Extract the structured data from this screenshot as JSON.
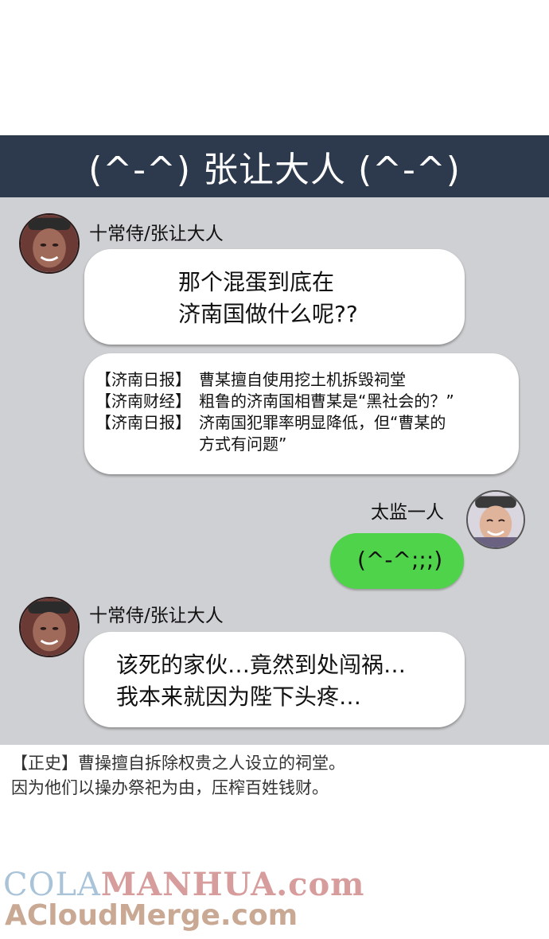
{
  "header": {
    "title": "(^-^) 张让大人 (^-^)"
  },
  "messages": [
    {
      "sender": "十常侍/张让大人",
      "text": "那个混蛋到底在\n济南国做什么呢??"
    },
    {
      "news": [
        {
          "tag": "【济南日报】",
          "text": "曹某擅自使用挖土机拆毁祠堂"
        },
        {
          "tag": "【济南财经】",
          "text": "粗鲁的济南国相曹某是“黑社会的？”"
        },
        {
          "tag": "【济南日报】",
          "text": "济南国犯罪率明显降低，但“曹某的\n方式有问题”"
        }
      ]
    },
    {
      "sender": "太监一人",
      "text": "(^-^;;;)"
    },
    {
      "sender": "十常侍/张让大人",
      "text": "该死的家伙…竟然到处闯祸…\n我本来就因为陛下头疼…"
    }
  ],
  "footnote": "【正史】曹操擅自拆除权贵之人设立的祠堂。\n因为他们以操办祭祀为由，压榨百姓钱财。",
  "watermark": {
    "part1": "COLA",
    "part2": "MANHUA.com",
    "line2": "ACloudMerge.com"
  },
  "colors": {
    "header_bg": "#2d3a4d",
    "chat_bg": "#cfd0d3",
    "self_bubble": "#4fd34a"
  }
}
